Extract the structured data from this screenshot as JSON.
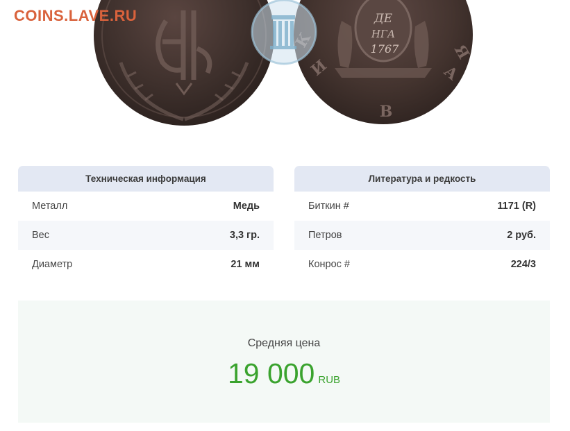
{
  "watermark": {
    "site": "COINS.LAVE.RU"
  },
  "coin": {
    "obverse": {
      "label": "",
      "monogram": "E II"
    },
    "reverse": {
      "value_line1": "ДЕ",
      "value_line2": "НГА",
      "year": "1767"
    }
  },
  "technical": {
    "title": "Техническая информация",
    "rows": [
      {
        "label": "Металл",
        "value": "Медь"
      },
      {
        "label": "Вес",
        "value": "3,3 гр."
      },
      {
        "label": "Диаметр",
        "value": "21 мм"
      }
    ]
  },
  "literature": {
    "title": "Литература и редкость",
    "rows": [
      {
        "label": "Биткин #",
        "value": "1171 (R)"
      },
      {
        "label": "Петров",
        "value": "2 руб."
      },
      {
        "label": "Конрос #",
        "value": "224/3"
      }
    ]
  },
  "price": {
    "label": "Средняя цена",
    "value": "19 000",
    "currency": "RUB"
  },
  "colors": {
    "header_bg": "#e3e8f3",
    "price_green": "#3aa32e",
    "watermark_orange": "#d9623c",
    "price_bg": "#f4f9f6"
  }
}
